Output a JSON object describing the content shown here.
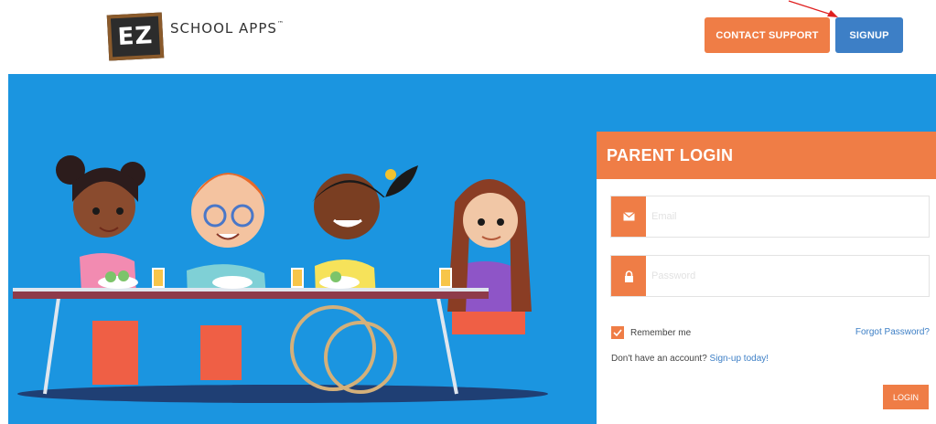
{
  "header": {
    "logo_mark": "EZ",
    "logo_text": "SCHOOL APPS",
    "logo_tm": "™",
    "contact_support_label": "CONTACT SUPPORT",
    "signup_label": "SIGNUP"
  },
  "login": {
    "title": "PARENT LOGIN",
    "email_placeholder": "Email",
    "password_placeholder": "Password",
    "remember_label": "Remember me",
    "remember_checked": true,
    "forgot_label": "Forgot Password?",
    "no_account_text": "Don't have an account? ",
    "signup_link": "Sign-up today!",
    "login_button": "LOGIN"
  },
  "colors": {
    "accent_orange": "#ef7d46",
    "accent_blue": "#3d7fc6",
    "hero_blue": "#1b95e0"
  }
}
